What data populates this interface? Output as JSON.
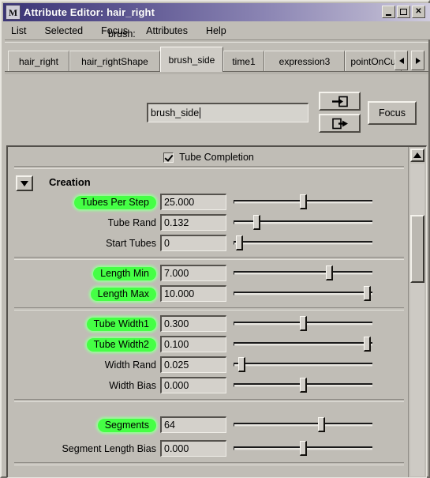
{
  "window": {
    "title": "Attribute Editor: hair_right",
    "app_icon": "maya-m-icon",
    "buttons": {
      "minimize": "_",
      "maximize": "□",
      "close": "×"
    }
  },
  "menubar": {
    "items": [
      {
        "label": "List"
      },
      {
        "label": "Selected"
      },
      {
        "label": "Focus"
      },
      {
        "label": "Attributes"
      },
      {
        "label": "Help"
      }
    ]
  },
  "tabs": {
    "items": [
      {
        "label": "hair_right",
        "selected": false
      },
      {
        "label": "hair_rightShape",
        "selected": false
      },
      {
        "label": "brush_side",
        "selected": true
      },
      {
        "label": "time1",
        "selected": false
      },
      {
        "label": "expression3",
        "selected": false
      },
      {
        "label": "pointOnCu",
        "selected": false
      }
    ],
    "scroll_left": "left-arrow-icon",
    "scroll_right": "right-arrow-icon"
  },
  "node_header": {
    "label": "brush:",
    "value": "brush_side",
    "connect_in_icon": "arrow-into-box-icon",
    "connect_out_icon": "arrow-out-of-box-icon",
    "focus_label": "Focus"
  },
  "panel": {
    "tube_completion": {
      "label": "Tube Completion",
      "checked": true
    },
    "section": {
      "title": "Creation",
      "collapse_icon": "chevron-down-icon",
      "expanded": true
    },
    "groups": [
      {
        "rows": [
          {
            "label": "Tubes Per Step",
            "value": "25.000",
            "keyed": true,
            "slider_pct": 49
          },
          {
            "label": "Tube Rand",
            "value": "0.132",
            "keyed": false,
            "slider_pct": 15
          },
          {
            "label": "Start Tubes",
            "value": "0",
            "keyed": false,
            "slider_pct": 2
          }
        ]
      },
      {
        "rows": [
          {
            "label": "Length Min",
            "value": "7.000",
            "keyed": true,
            "slider_pct": 68
          },
          {
            "label": "Length Max",
            "value": "10.000",
            "keyed": true,
            "slider_pct": 96
          }
        ]
      },
      {
        "rows": [
          {
            "label": "Tube Width1",
            "value": "0.300",
            "keyed": true,
            "slider_pct": 49
          },
          {
            "label": "Tube Width2",
            "value": "0.100",
            "keyed": true,
            "slider_pct": 96
          },
          {
            "label": "Width Rand",
            "value": "0.025",
            "keyed": false,
            "slider_pct": 4
          },
          {
            "label": "Width Bias",
            "value": "0.000",
            "keyed": false,
            "slider_pct": 49
          }
        ]
      },
      {
        "rows": [
          {
            "label": "Segments",
            "value": "64",
            "keyed": true,
            "slider_pct": 62
          },
          {
            "label": "Segment Length Bias",
            "value": "0.000",
            "keyed": false,
            "slider_pct": 49
          }
        ]
      }
    ]
  },
  "scrollbar": {
    "up_icon": "scroll-up-arrow-icon",
    "thumb_top_pct": 16,
    "thumb_height_pct": 21
  },
  "colors": {
    "window_bg": "#c0bdb6",
    "title_gradient_start": "#3b3576",
    "title_gradient_end": "#cfcbdd",
    "keyed_attr_green": "#45ff45",
    "field_bg": "#d4d1cb"
  }
}
